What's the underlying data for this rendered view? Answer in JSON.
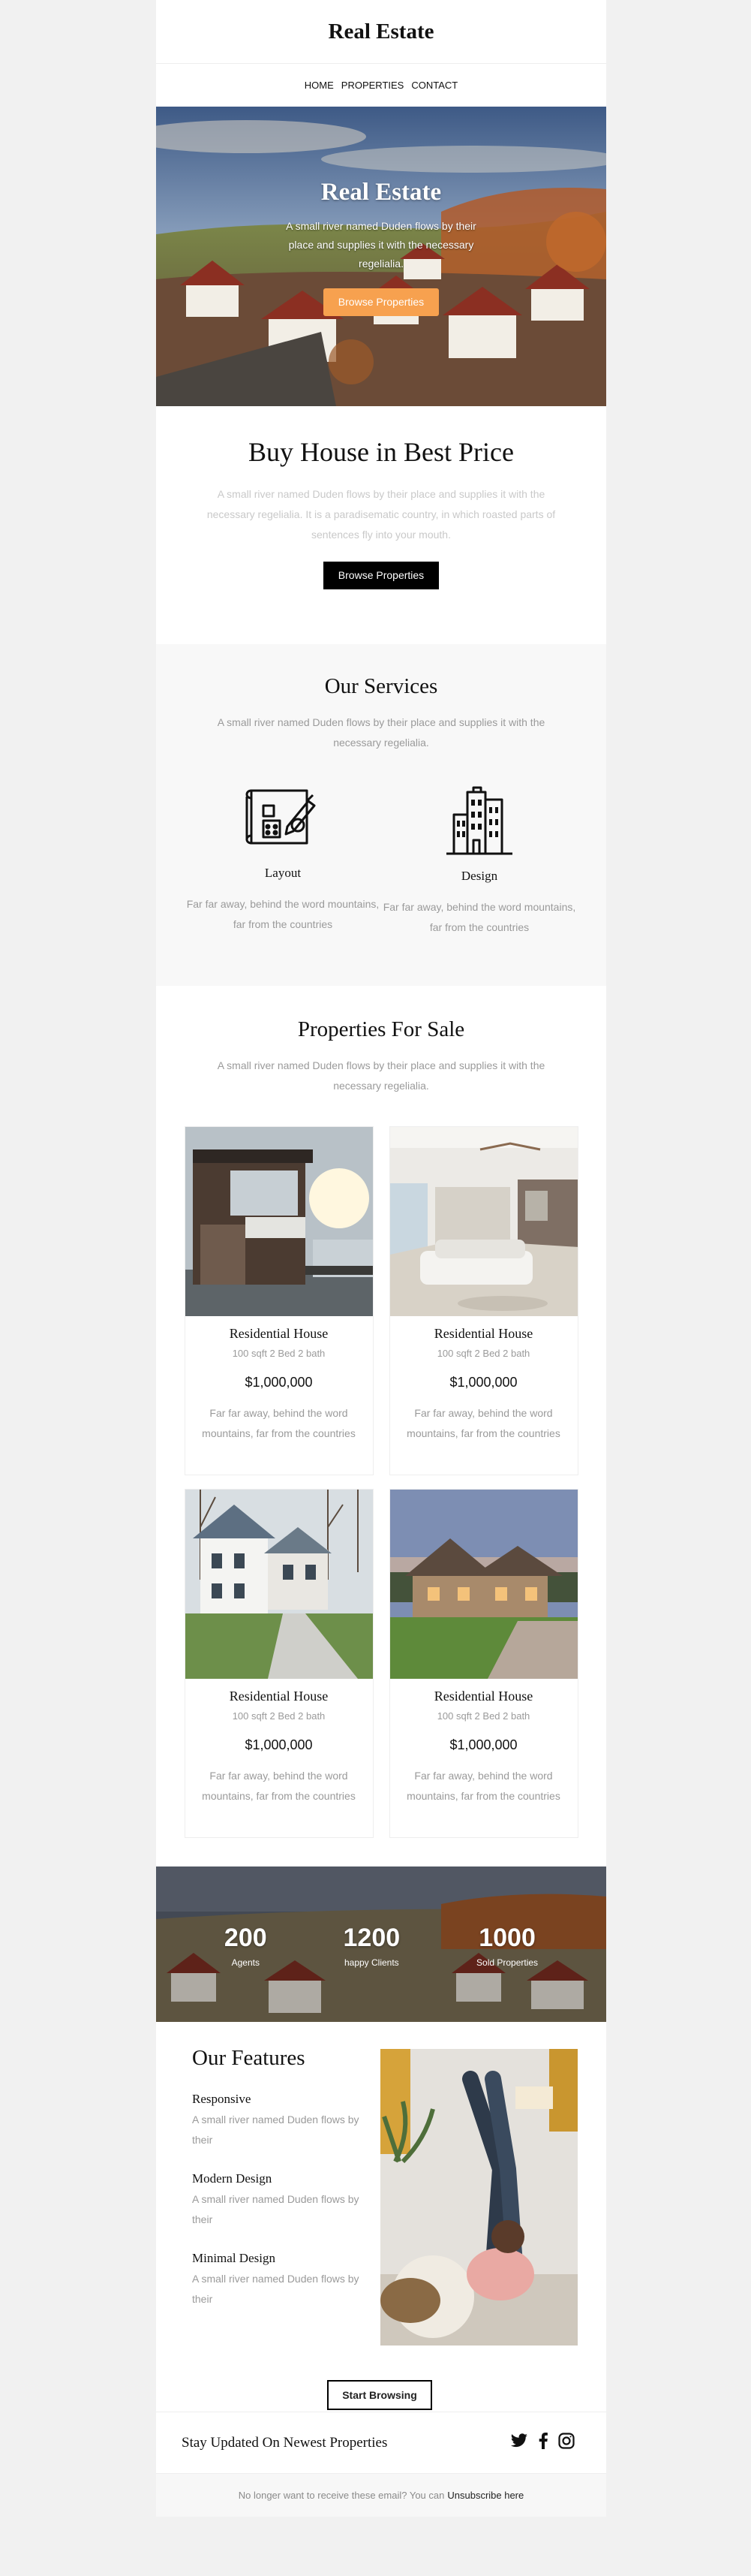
{
  "header": {
    "logo": "Real Estate"
  },
  "nav": {
    "items": [
      "HOME",
      "PROPERTIES",
      "CONTACT"
    ]
  },
  "hero": {
    "title": "Real Estate",
    "text": "A small river named Duden flows by their place and supplies it with the necessary regelialia.",
    "button": "Browse Properties"
  },
  "intro": {
    "title": "Buy House in Best Price",
    "text": "A small river named Duden flows by their place and supplies it with the necessary regelialia. It is a paradisematic country, in which roasted parts of sentences fly into your mouth.",
    "button": "Browse Properties"
  },
  "services": {
    "title": "Our Services",
    "text": "A small river named Duden flows by their place and supplies it with the necessary regelialia.",
    "items": [
      {
        "title": "Layout",
        "text": "Far far away, behind the word mountains, far from the countries",
        "icon": "blueprint-icon"
      },
      {
        "title": "Design",
        "text": "Far far away, behind the word mountains, far from the countries",
        "icon": "buildings-icon"
      }
    ]
  },
  "properties": {
    "title": "Properties For Sale",
    "text": "A small river named Duden flows by their place and supplies it with the necessary regelialia.",
    "items": [
      {
        "name": "Residential House",
        "spec": "100 sqft 2 Bed 2 bath",
        "price": "$1,000,000",
        "text": "Far far away, behind the word mountains, far from the countries"
      },
      {
        "name": "Residential House",
        "spec": "100 sqft 2 Bed 2 bath",
        "price": "$1,000,000",
        "text": "Far far away, behind the word mountains, far from the countries"
      },
      {
        "name": "Residential House",
        "spec": "100 sqft 2 Bed 2 bath",
        "price": "$1,000,000",
        "text": "Far far away, behind the word mountains, far from the countries"
      },
      {
        "name": "Residential House",
        "spec": "100 sqft 2 Bed 2 bath",
        "price": "$1,000,000",
        "text": "Far far away, behind the word mountains, far from the countries"
      }
    ]
  },
  "stats": [
    {
      "value": "200",
      "label": "Agents"
    },
    {
      "value": "1200",
      "label": "happy Clients"
    },
    {
      "value": "1000",
      "label": "Sold Properties"
    }
  ],
  "features": {
    "title": "Our Features",
    "items": [
      {
        "title": "Responsive",
        "text": "A small river named Duden flows by their"
      },
      {
        "title": "Modern Design",
        "text": "A small river named Duden flows by their"
      },
      {
        "title": "Minimal Design",
        "text": "A small river named Duden flows by their"
      }
    ],
    "button": "Start Browsing"
  },
  "footer": {
    "stay": "Stay Updated On Newest Properties",
    "unsub_text": "No longer want to receive these email? You can",
    "unsub_link": "Unsubscribe here",
    "socials": [
      "twitter-icon",
      "facebook-icon",
      "instagram-icon"
    ]
  },
  "colors": {
    "accent": "#f7a14f",
    "dark": "#000000",
    "muted": "#9a9a9a",
    "section_bg": "#f8f8f8"
  }
}
